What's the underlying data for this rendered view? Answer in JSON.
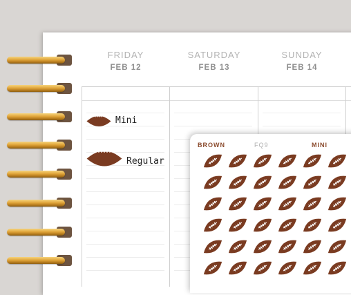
{
  "days": [
    {
      "name": "FRIDAY",
      "date": "FEB 12"
    },
    {
      "name": "SATURDAY",
      "date": "FEB 13"
    },
    {
      "name": "SUNDAY",
      "date": "FEB 14"
    }
  ],
  "key": {
    "mini_label": "Mini",
    "regular_label": "Regular"
  },
  "sheet": {
    "color_label": "BROWN",
    "code_label": "FQ9",
    "size_label": "MINI"
  },
  "icons": {
    "sticker": "football-icon",
    "binding": "spiral-ring-icon"
  },
  "colors": {
    "football": "#7a3b21",
    "lace": "#ffffff",
    "header_accent": "#8a4a2c",
    "background": "#d9d6d3"
  }
}
